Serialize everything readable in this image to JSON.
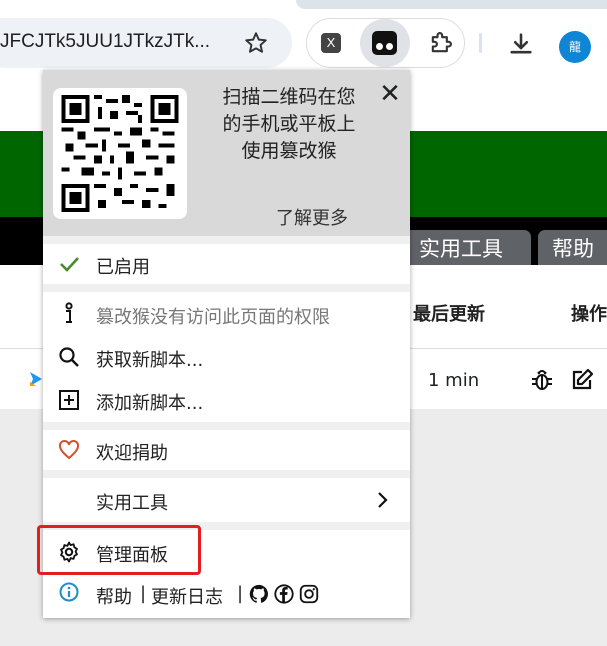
{
  "browser": {
    "url_text": "JFCJTk5JUU1JTkzJTk...",
    "extensions": {
      "x_label": "X"
    },
    "profile_avatar": "龍",
    "icons": [
      "star-icon",
      "x-extension-icon",
      "tampermonkey-icon",
      "puzzle-icon",
      "download-icon"
    ]
  },
  "page": {
    "tabs": [
      "实用工具",
      "帮助"
    ],
    "columns": [
      "最后更新",
      "操作"
    ],
    "row": {
      "updated": "1 min"
    }
  },
  "popup": {
    "qr_text": "扫描二维码在您的手机或平板上使用篡改猴",
    "learn_more": "了解更多",
    "close_symbol": "✕",
    "items": {
      "enabled": "已启用",
      "no_permission": "篡改猴没有访问此页面的权限",
      "get_scripts": "获取新脚本...",
      "add_script": "添加新脚本...",
      "donate": "欢迎捐助",
      "utilities": "实用工具",
      "dashboard": "管理面板"
    },
    "footer": {
      "help": "帮助",
      "sep1": "|",
      "changelog": "更新日志",
      "sep2": "|"
    },
    "colors": {
      "check": "#4a8a2a",
      "heart": "#d2522f",
      "info": "#1a8fc9",
      "highlight": "#e41e1e"
    }
  }
}
